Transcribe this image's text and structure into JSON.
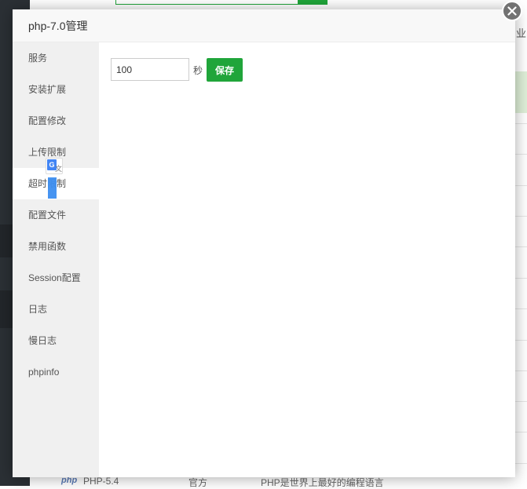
{
  "background": {
    "header_fragment": "业",
    "bottom_row": {
      "logo": "php",
      "name": "PHP-5.4",
      "type": "官方",
      "description": "PHP是世界上最好的编程语言"
    }
  },
  "modal": {
    "title": "php-7.0管理",
    "close_icon": "close-icon",
    "sidebar": {
      "items": [
        {
          "label": "服务"
        },
        {
          "label": "安装扩展"
        },
        {
          "label": "配置修改"
        },
        {
          "label": "上传限制"
        },
        {
          "label": "超时限制",
          "active": true
        },
        {
          "label": "配置文件"
        },
        {
          "label": "禁用函数"
        },
        {
          "label": "Session配置"
        },
        {
          "label": "日志"
        },
        {
          "label": "慢日志"
        },
        {
          "label": "phpinfo"
        }
      ]
    },
    "content": {
      "timeout_value": "100",
      "unit": "秒",
      "save_label": "保存"
    }
  },
  "translate_widget": {
    "icon": "google-translate-icon",
    "glyph_g": "G",
    "glyph_a": "文"
  },
  "colors": {
    "accent": "#20a53a",
    "sidebar_bg": "#f0f0f0",
    "close_bg": "#727272"
  }
}
